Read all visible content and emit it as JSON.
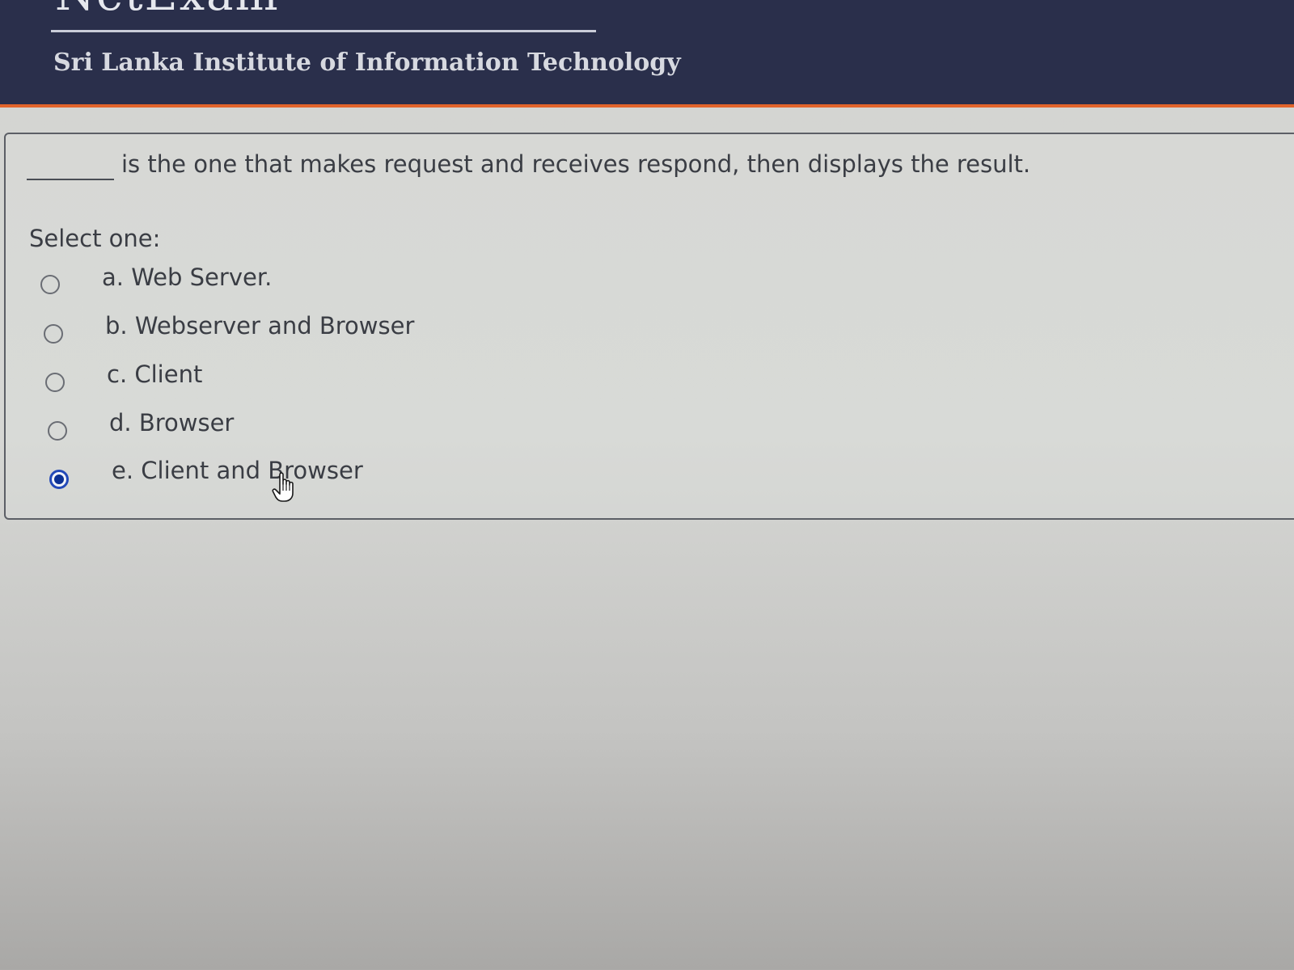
{
  "header": {
    "logo_text": "NetExam",
    "institute_name": "Sri Lanka Institute of Information Technology",
    "background_color": "#2a2f4b",
    "accent_color": "#e2642b"
  },
  "question": {
    "text": "is the one that makes request and receives respond, then displays the result.",
    "select_prompt": "Select one:",
    "options": [
      {
        "label": "a. Web Server.",
        "selected": false
      },
      {
        "label": "b. Webserver and Browser",
        "selected": false
      },
      {
        "label": "c. Client",
        "selected": false
      },
      {
        "label": "d. Browser",
        "selected": false
      },
      {
        "label": "e. Client and Browser",
        "selected": true
      }
    ],
    "selected_color": "#0c3194"
  },
  "cursor": {
    "icon": "hand-pointer-icon"
  }
}
